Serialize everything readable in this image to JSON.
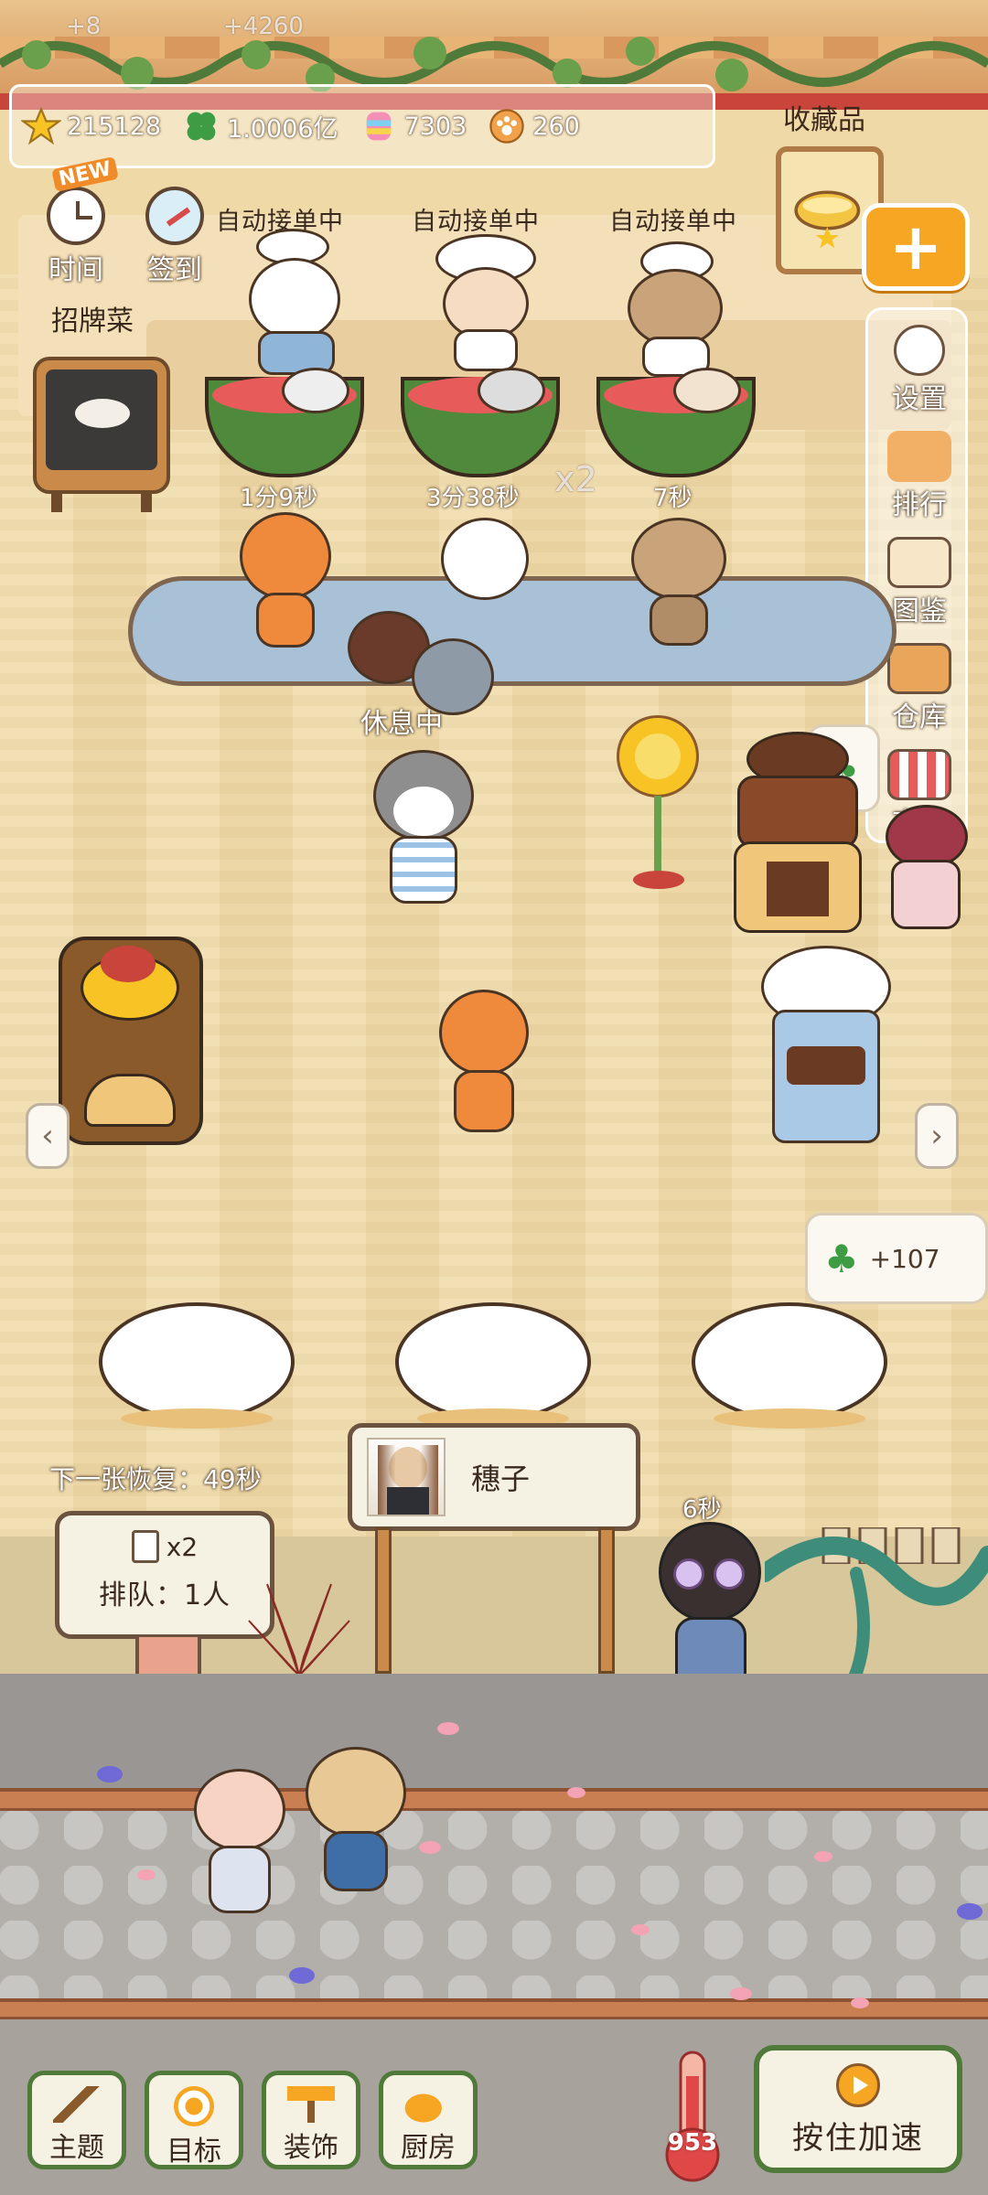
{
  "top_faded": {
    "left": "+8",
    "right": "+4260"
  },
  "resources": {
    "stars": "215128",
    "clovers": "1.0006亿",
    "candy": "7303",
    "coins": "260"
  },
  "collection_label": "收藏品",
  "top_buttons": {
    "time": "时间",
    "checkin": "签到",
    "new_badge": "NEW"
  },
  "auto_order": [
    "自动接单中",
    "自动接单中",
    "自动接单中"
  ],
  "signature_label": "招牌菜",
  "pot_timers": [
    "1分9秒",
    "3分38秒",
    "7秒"
  ],
  "faded_bonus": "x2",
  "side_menu": [
    "设置",
    "排行",
    "图鉴",
    "仓库",
    "商城"
  ],
  "resting": "休息中",
  "clover_popup_top": "",
  "clover_popup_right": "+107",
  "next_card": "下一张恢复：49秒",
  "queue": {
    "count": "x2",
    "text": "排队：1人"
  },
  "customer_name": "穗子",
  "customer_timer": "6秒",
  "bottom_nav": [
    "主题",
    "目标",
    "装饰",
    "厨房"
  ],
  "thermometer_value": "953",
  "speed_button": "按住加速",
  "colors": {
    "accent": "#f6a623",
    "green": "#4f7a3a",
    "roof_red": "#c9443b"
  }
}
